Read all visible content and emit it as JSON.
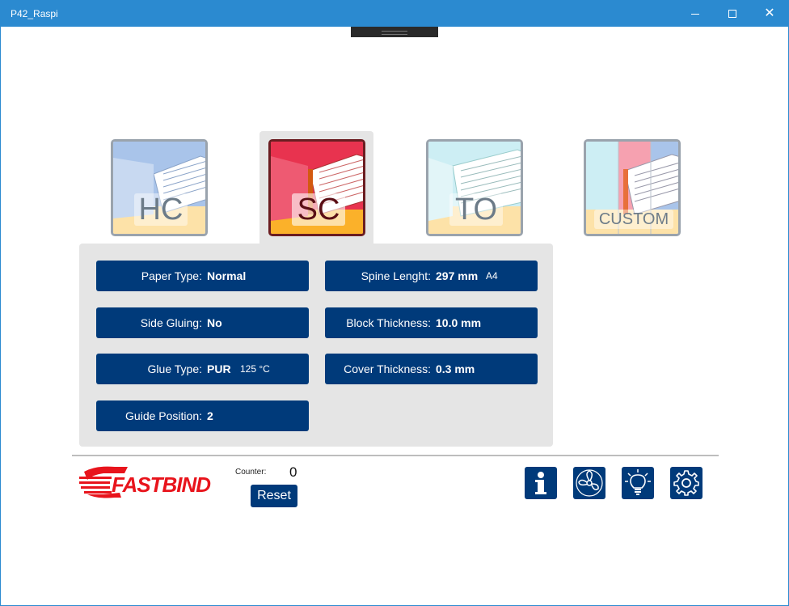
{
  "window": {
    "title": "P42_Raspi",
    "close_glyph": "✕"
  },
  "modes": [
    {
      "label": "HC",
      "selected": false
    },
    {
      "label": "SC",
      "selected": true
    },
    {
      "label": "TO",
      "selected": false
    },
    {
      "label": "CUSTOM",
      "selected": false
    }
  ],
  "fields": {
    "paper_type": {
      "label": "Paper Type:",
      "value": "Normal"
    },
    "side_gluing": {
      "label": "Side Gluing:",
      "value": "No"
    },
    "glue_type": {
      "label": "Glue Type:",
      "value": "PUR",
      "extra": "125 °C"
    },
    "guide_position": {
      "label": "Guide Position:",
      "value": "2"
    },
    "spine_length": {
      "label": "Spine Lenght:",
      "value": "297 mm",
      "extra": "A4"
    },
    "block_thickness": {
      "label": "Block Thickness:",
      "value": "10.0 mm"
    },
    "cover_thickness": {
      "label": "Cover Thickness:",
      "value": "0.3 mm"
    }
  },
  "footer": {
    "brand": "FASTBIND",
    "counter_label": "Counter:",
    "counter_value": "0",
    "reset_label": "Reset",
    "icons": [
      "info-icon",
      "fan-icon",
      "lightbulb-icon",
      "gear-icon"
    ]
  },
  "colors": {
    "titlebar": "#2b8ad0",
    "button": "#003a7a",
    "panel": "#e5e5e5",
    "brand_red": "#e8141c"
  }
}
